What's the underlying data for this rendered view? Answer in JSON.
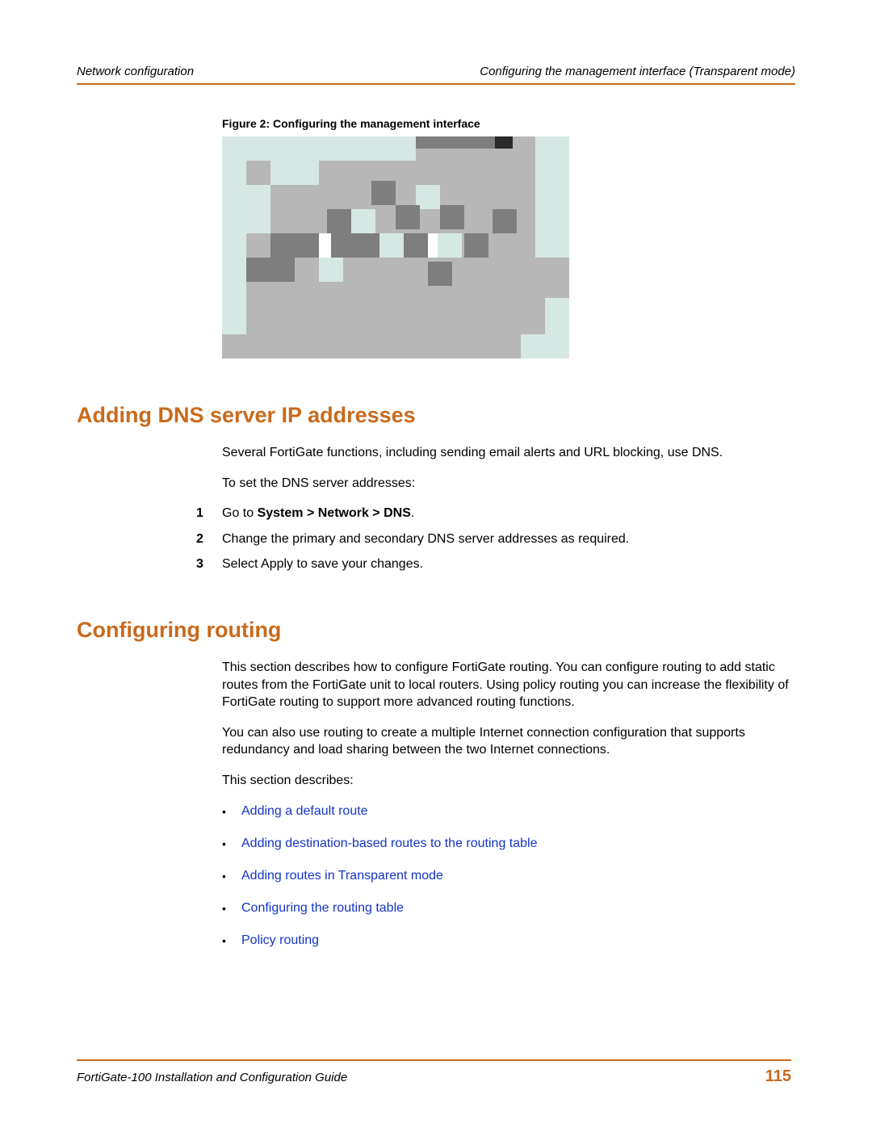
{
  "header": {
    "left": "Network configuration",
    "right": "Configuring the management interface (Transparent mode)"
  },
  "figure": {
    "caption": "Figure 2:   Configuring the management interface"
  },
  "sections": {
    "dns": {
      "title": "Adding DNS server IP addresses",
      "intro": "Several FortiGate functions, including sending email alerts and URL blocking, use DNS.",
      "lead": "To set the DNS server addresses:",
      "steps": [
        {
          "n": "1",
          "pre": "Go to ",
          "bold": "System > Network > DNS",
          "post": "."
        },
        {
          "n": "2",
          "text": "Change the primary and secondary DNS server addresses as required."
        },
        {
          "n": "3",
          "text": "Select Apply to save your changes."
        }
      ]
    },
    "routing": {
      "title": "Configuring routing",
      "p1": "This section describes how to configure FortiGate routing. You can configure routing to add static routes from the FortiGate unit to local routers. Using policy routing you can increase the flexibility of FortiGate routing to support more advanced routing functions.",
      "p2": "You can also use routing to create a multiple Internet connection configuration that supports redundancy and load sharing between the two Internet connections.",
      "p3": "This section describes:",
      "links": [
        "Adding a default route",
        "Adding destination-based routes to the routing table",
        "Adding routes in Transparent mode",
        "Configuring the routing table",
        "Policy routing"
      ]
    }
  },
  "footer": {
    "left": "FortiGate-100 Installation and Configuration Guide",
    "page": "115"
  }
}
